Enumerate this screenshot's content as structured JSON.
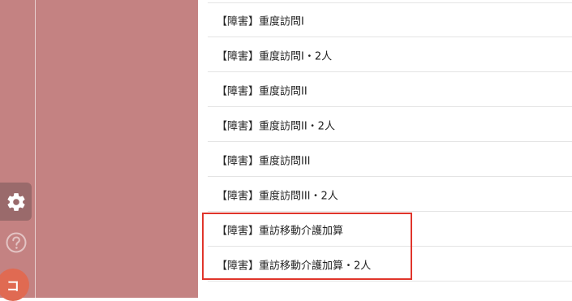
{
  "sidebar": {
    "settings_icon": "gear-icon",
    "help_icon": "question-circle-icon",
    "avatar_initial": "コ",
    "accent_color": "#c48282",
    "avatar_color": "#e06a52"
  },
  "service_list": {
    "items": [
      {
        "label": "【障害】重度訪問I"
      },
      {
        "label": "【障害】重度訪問I・2人"
      },
      {
        "label": "【障害】重度訪問II"
      },
      {
        "label": "【障害】重度訪問II・2人"
      },
      {
        "label": "【障害】重度訪問III"
      },
      {
        "label": "【障害】重度訪問III・2人"
      },
      {
        "label": "【障害】重訪移動介護加算"
      },
      {
        "label": "【障害】重訪移動介護加算・2人"
      }
    ],
    "highlight_color": "#e0352b"
  }
}
